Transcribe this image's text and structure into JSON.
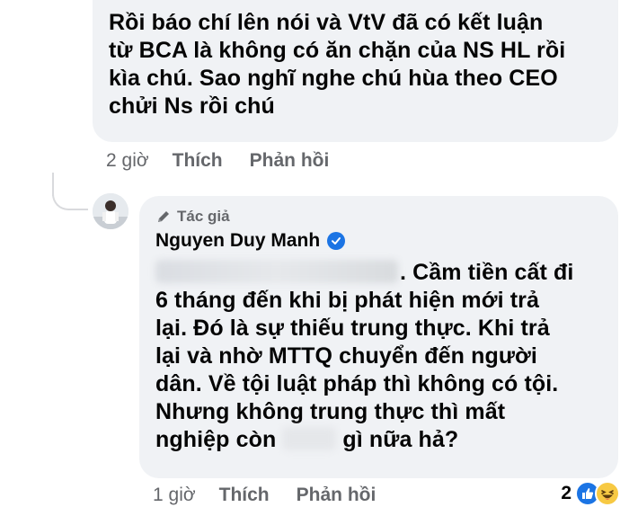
{
  "top_comment": {
    "lines": [
      "Rồi báo chí lên nói và VtV đã có kết luận",
      "từ BCA là không có ăn chặn của NS HL rồi",
      "kìa chú. Sao nghĩ nghe chú hùa theo CEO",
      "chửi Ns rồi chú"
    ],
    "time": "2 giờ",
    "like_label": "Thích",
    "reply_label": "Phản hồi"
  },
  "reply": {
    "author_badge": "Tác giả",
    "author_name": "Nguyen Duy Manh",
    "first_line_rest": ". Cầm tiền cất đi",
    "lines": [
      "6 tháng đến khi bị phát hiện mới trả",
      "lại. Đó là sự thiếu trung thực. Khi trả",
      "lại và nhờ MTTQ chuyển đến người",
      "dân. Về tội luật pháp thì không có tội.",
      "Nhưng không trung thực thì mất"
    ],
    "last_line_start": "nghiệp còn ",
    "last_line_end": " gì nữa hả?",
    "time": "1 giờ",
    "like_label": "Thích",
    "reply_label": "Phản hồi",
    "reaction_count": "2",
    "reaction_icons": [
      "like-icon",
      "haha-icon"
    ]
  },
  "colors": {
    "bubble": "#f0f2f5",
    "secondary_text": "#65676b",
    "verified": "#1b74e4"
  }
}
